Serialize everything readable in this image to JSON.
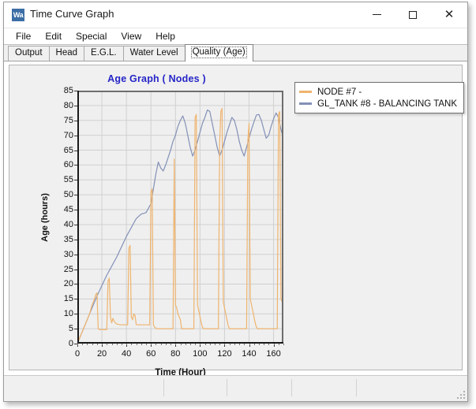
{
  "window": {
    "title": "Time Curve Graph",
    "app_icon": "Wa",
    "minimize_label": "–",
    "maximize_label": "",
    "close_label": "✕"
  },
  "menu": {
    "items": [
      {
        "label": "File"
      },
      {
        "label": "Edit"
      },
      {
        "label": "Special"
      },
      {
        "label": "View"
      },
      {
        "label": "Help"
      }
    ]
  },
  "tabs": {
    "items": [
      {
        "label": "Output",
        "selected": false
      },
      {
        "label": "Head",
        "selected": false
      },
      {
        "label": "E.G.L.",
        "selected": false
      },
      {
        "label": "Water Level",
        "selected": false
      },
      {
        "label": "Quality (Age)",
        "selected": true
      }
    ]
  },
  "colors": {
    "title_text": "#2525c8",
    "series_node7": "#efb46e",
    "series_tank8": "#8391b7",
    "plot_background": "#efefef",
    "panel_background": "#f0f0f0",
    "grid": "#d0d0d0"
  },
  "chart_data": {
    "type": "line",
    "title": "Age Graph ( Nodes )",
    "xlabel": "Time (Hour)",
    "ylabel": "Age (hours)",
    "xlim": [
      0,
      168
    ],
    "ylim": [
      0,
      85
    ],
    "xticks": [
      0,
      20,
      40,
      60,
      80,
      100,
      120,
      140,
      160
    ],
    "yticks": [
      0,
      5,
      10,
      15,
      20,
      25,
      30,
      35,
      40,
      45,
      50,
      55,
      60,
      65,
      70,
      75,
      80,
      85
    ],
    "grid": true,
    "legend_position": "right-outside",
    "series": [
      {
        "name": "NODE #7 -",
        "color": "#efb46e",
        "x": [
          0,
          6,
          10,
          12,
          13,
          14,
          15,
          16,
          17,
          18,
          19,
          20,
          21,
          22,
          23,
          24,
          25,
          26,
          27,
          28,
          29,
          30,
          31,
          32,
          33,
          34,
          35,
          36,
          37,
          38,
          39,
          40,
          41,
          42,
          43,
          44,
          45,
          46,
          47,
          48,
          49,
          50,
          51,
          52,
          53,
          54,
          55,
          56,
          57,
          58,
          59,
          60,
          61,
          62,
          63,
          64,
          65,
          66,
          67,
          68,
          69,
          70,
          71,
          72,
          73,
          74,
          75,
          76,
          77,
          78,
          79,
          80,
          81,
          82,
          83,
          84,
          85,
          86,
          87,
          88,
          89,
          90,
          91,
          92,
          93,
          94,
          95,
          96,
          97,
          98,
          99,
          100,
          101,
          102,
          103,
          104,
          105,
          106,
          107,
          108,
          109,
          110,
          111,
          112,
          113,
          114,
          115,
          116,
          117,
          118,
          119,
          120,
          121,
          122,
          123,
          124,
          125,
          126,
          127,
          128,
          129,
          130,
          131,
          132,
          133,
          134,
          135,
          136,
          137,
          138,
          139,
          140,
          141,
          142,
          143,
          144,
          145,
          146,
          147,
          148,
          149,
          150,
          151,
          152,
          153,
          154,
          155,
          156,
          157,
          158,
          159,
          160,
          161,
          162,
          163,
          164,
          165,
          166,
          167,
          168
        ],
        "y": [
          0,
          6,
          10,
          13,
          14,
          15,
          16.5,
          17,
          5,
          4.7,
          4.7,
          4.7,
          4.7,
          4.7,
          4.7,
          4.7,
          21,
          22,
          9,
          7,
          8.5,
          7.5,
          7,
          6.6,
          6.5,
          6.4,
          6.3,
          6.3,
          6.3,
          6.3,
          6.3,
          6.3,
          6.3,
          32,
          33,
          9,
          8,
          10,
          9.5,
          6.4,
          6.3,
          6.3,
          6.3,
          6.3,
          6.3,
          6.3,
          6.3,
          6.3,
          6.3,
          6.3,
          6.3,
          51,
          52,
          6.3,
          5.5,
          5.2,
          5,
          5,
          5,
          5,
          5,
          5,
          5,
          5,
          5,
          5,
          5,
          5,
          5,
          5,
          62,
          13,
          12,
          10,
          9,
          8,
          5,
          5,
          5,
          5,
          5,
          5,
          5,
          5,
          5,
          5,
          5,
          76,
          77,
          13,
          11,
          9,
          7,
          5.5,
          5,
          5,
          5,
          5,
          5,
          5,
          5,
          5,
          5,
          5,
          5,
          5,
          5,
          67,
          78,
          79,
          14,
          12,
          10,
          8,
          6,
          5,
          5,
          5,
          5,
          5,
          5,
          5,
          5,
          5,
          5,
          5,
          5,
          5,
          5,
          5,
          68,
          74,
          15,
          13,
          11,
          9,
          7,
          5.5,
          5,
          5,
          5,
          5,
          5,
          5,
          5,
          5,
          5,
          5,
          5,
          5,
          5,
          5,
          5,
          5,
          5,
          77,
          78,
          15,
          14
        ]
      },
      {
        "name": "GL_TANK #8 - BALANCING TANK",
        "color": "#8391b7",
        "x": [
          0,
          4,
          8,
          12,
          16,
          20,
          24,
          28,
          32,
          36,
          40,
          44,
          48,
          52,
          56,
          60,
          62,
          64,
          66,
          68,
          70,
          72,
          74,
          76,
          78,
          80,
          82,
          84,
          86,
          88,
          90,
          92,
          94,
          96,
          98,
          100,
          102,
          104,
          106,
          108,
          110,
          112,
          114,
          116,
          118,
          120,
          122,
          124,
          126,
          128,
          130,
          132,
          134,
          136,
          138,
          140,
          142,
          144,
          146,
          148,
          150,
          152,
          154,
          156,
          158,
          160,
          162,
          164,
          166,
          168
        ],
        "y": [
          0,
          4,
          8,
          12,
          16,
          19.5,
          23,
          26,
          29,
          32.5,
          36,
          39,
          42,
          43.5,
          44,
          47,
          52,
          57,
          61,
          59,
          58,
          60,
          62.5,
          65,
          68,
          70,
          73,
          75,
          76.5,
          74,
          70,
          66,
          63,
          65,
          68,
          71,
          74,
          76,
          78.5,
          78,
          74,
          70,
          66,
          63,
          65,
          68,
          71,
          73.5,
          76,
          75,
          72,
          68,
          65,
          63,
          66,
          69,
          72,
          74.5,
          76.8,
          77,
          75,
          72,
          69,
          70,
          73,
          75.5,
          77.5,
          76,
          72,
          69
        ]
      }
    ]
  },
  "legend": {
    "entries": [
      {
        "label": "NODE #7 -",
        "color": "#efb46e"
      },
      {
        "label": "GL_TANK #8 - BALANCING TANK",
        "color": "#8391b7"
      }
    ]
  },
  "statusbar": {
    "cells": [
      "",
      "",
      "",
      "",
      ""
    ]
  }
}
